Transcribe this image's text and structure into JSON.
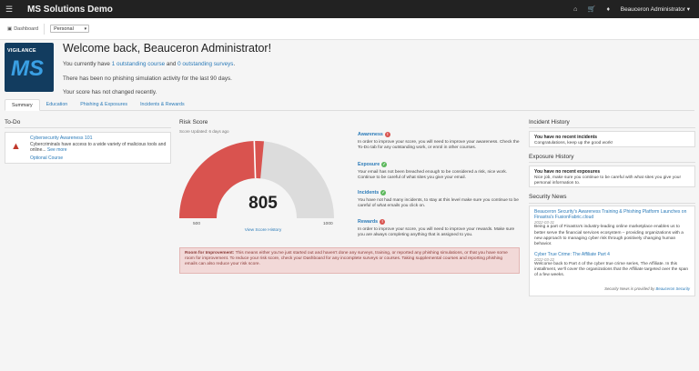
{
  "topbar": {
    "title": "MS Solutions Demo",
    "user": "Beauceron Administrator"
  },
  "breadcrumb": {
    "label": "Dashboard",
    "view_select": "Personal"
  },
  "logo": {
    "tagline": "VIGILANCE",
    "mark": "MS"
  },
  "welcome": {
    "title": "Welcome back, Beauceron Administrator!",
    "line1_prefix": "You currently have ",
    "line1_link1": "1 outstanding course",
    "line1_mid": " and ",
    "line1_link2": "0 outstanding surveys",
    "line1_suffix": ".",
    "line2": "There has been no phishing simulation activity for the last 90 days.",
    "line3": "Your score has not changed recently."
  },
  "tabs": [
    "Summary",
    "Education",
    "Phishing & Exposures",
    "Incidents & Rewards"
  ],
  "todo": {
    "heading": "To-Do",
    "item_title": "Cybersecurity Awareness 101",
    "item_desc": "Cybercriminals have access to a wide variety of malicious tools and online... ",
    "see_more": "See more",
    "optional": "Optional Course"
  },
  "risk": {
    "heading": "Risk Score",
    "updated": "Score Updated: 6 days ago",
    "score": "805",
    "min": "500",
    "max": "1000",
    "history_link": "View Score History",
    "range_min": 500,
    "range_max": 1000,
    "fill_fraction": 0.53,
    "colors": {
      "fill": "#d9534f",
      "empty": "#dcdcdc"
    }
  },
  "details": [
    {
      "title": "Awareness",
      "status": "bad",
      "body": "In order to improve your score, you will need to improve your awareness. Check the To-Do tab for any outstanding work, or enrol in other courses."
    },
    {
      "title": "Exposure",
      "status": "ok",
      "body": "Your email has not been breached enough to be considered a risk, nice work. Continue to be careful of what sites you give your email."
    },
    {
      "title": "Incidents",
      "status": "ok",
      "body": "You have not had many incidents, to stay at this level make sure you continue to be careful of what emails you click on."
    },
    {
      "title": "Rewards",
      "status": "bad",
      "body": "In order to improve your score, you will need to improve your rewards. Make sure you are always completing anything that is assigned to you."
    }
  ],
  "improvement": {
    "label": "Room for Improvement:",
    "text": " This means either you've just started out and haven't done any surveys, training, or reported any phishing simulations, or that you have some room for improvement. To reduce your risk score, check your Dashboard for any incomplete surveys or courses. Taking supplemental courses and reporting phishing emails can also reduce your risk score."
  },
  "incident_history": {
    "heading": "Incident History",
    "title": "You have no recent incidents",
    "body": "Congratulations, keep up the good work!"
  },
  "exposure_history": {
    "heading": "Exposure History",
    "title": "You have no recent exposures",
    "body": "Nice job, make sure you continue to be careful with what sites you give your personal information to."
  },
  "news": {
    "heading": "Security News",
    "items": [
      {
        "title": "Beauceron Security's Awareness Training & Phishing Platform Launches on Finastra's FusionFabric.cloud",
        "date": "2022-03-31",
        "body": "Being a part of Finastra's industry-leading online marketplace enables us to better serve the financial services ecosystem – providing organizations with a new approach to managing cyber risk through positively changing human behavior."
      },
      {
        "title": "Cyber True Crime: The Affiliate Part 4",
        "date": "2022-03-22",
        "body": "Welcome back to Part 4 of the cyber true crime series, The Affiliate. In this installment, we'll cover the organizations that the Affiliate targeted over the span of a few weeks."
      }
    ],
    "footer_prefix": "Security News is provided by ",
    "footer_link": "Beauceron Security"
  }
}
